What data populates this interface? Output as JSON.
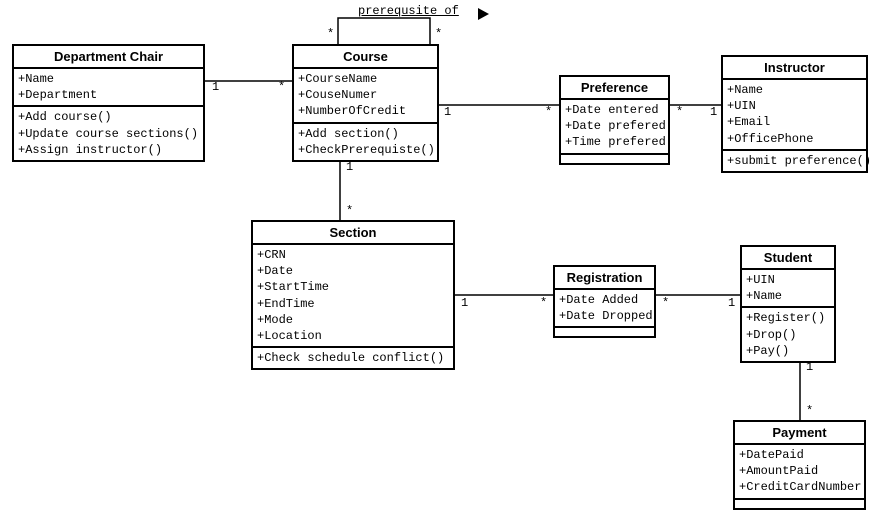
{
  "chart_data": {
    "type": "uml_class_diagram",
    "classes": [
      {
        "id": "department_chair",
        "name": "Department Chair",
        "attributes": [
          "+Name",
          "+Department"
        ],
        "operations": [
          "+Add course()",
          "+Update course sections()",
          "+Assign instructor()"
        ]
      },
      {
        "id": "course",
        "name": "Course",
        "attributes": [
          "+CourseName",
          "+CouseNumer",
          "+NumberOfCredit"
        ],
        "operations": [
          "+Add section()",
          "+CheckPrerequiste()"
        ]
      },
      {
        "id": "preference",
        "name": "Preference",
        "attributes": [
          "+Date entered",
          "+Date prefered",
          "+Time prefered"
        ],
        "operations": []
      },
      {
        "id": "instructor",
        "name": "Instructor",
        "attributes": [
          "+Name",
          "+UIN",
          "+Email",
          "+OfficePhone"
        ],
        "operations": [
          "+submit preference()"
        ]
      },
      {
        "id": "section",
        "name": "Section",
        "attributes": [
          "+CRN",
          "+Date",
          "+StartTime",
          "+EndTime",
          "+Mode",
          "+Location"
        ],
        "operations": [
          "+Check schedule conflict()"
        ]
      },
      {
        "id": "registration",
        "name": "Registration",
        "attributes": [
          "+Date Added",
          "+Date Dropped"
        ],
        "operations": []
      },
      {
        "id": "student",
        "name": "Student",
        "attributes": [
          "+UIN",
          "+Name"
        ],
        "operations": [
          "+Register()",
          "+Drop()",
          "+Pay()"
        ]
      },
      {
        "id": "payment",
        "name": "Payment",
        "attributes": [
          "+DatePaid",
          "+AmountPaid",
          "+CreditCardNumber"
        ],
        "operations": []
      }
    ],
    "associations": [
      {
        "from": "department_chair",
        "to": "course",
        "from_mult": "1",
        "to_mult": "*"
      },
      {
        "from": "course",
        "to": "course",
        "label": "prerequsite of",
        "from_mult": "*",
        "to_mult": "*"
      },
      {
        "from": "course",
        "to": "preference",
        "from_mult": "1",
        "to_mult": "*"
      },
      {
        "from": "preference",
        "to": "instructor",
        "from_mult": "*",
        "to_mult": "1"
      },
      {
        "from": "course",
        "to": "section",
        "from_mult": "1",
        "to_mult": "*"
      },
      {
        "from": "section",
        "to": "registration",
        "from_mult": "1",
        "to_mult": "*"
      },
      {
        "from": "registration",
        "to": "student",
        "from_mult": "*",
        "to_mult": "1"
      },
      {
        "from": "student",
        "to": "payment",
        "from_mult": "1",
        "to_mult": "*"
      }
    ]
  },
  "dc": {
    "title": "Department Chair",
    "a0": "+Name",
    "a1": "+Department",
    "o0": "+Add course()",
    "o1": "+Update course sections()",
    "o2": "+Assign instructor()"
  },
  "course": {
    "title": "Course",
    "a0": "+CourseName",
    "a1": "+CouseNumer",
    "a2": "+NumberOfCredit",
    "o0": "+Add section()",
    "o1": "+CheckPrerequiste()"
  },
  "pref": {
    "title": "Preference",
    "a0": "+Date entered",
    "a1": "+Date prefered",
    "a2": "+Time prefered"
  },
  "instr": {
    "title": "Instructor",
    "a0": "+Name",
    "a1": "+UIN",
    "a2": "+Email",
    "a3": "+OfficePhone",
    "o0": "+submit preference()"
  },
  "section": {
    "title": "Section",
    "a0": "+CRN",
    "a1": "+Date",
    "a2": "+StartTime",
    "a3": "+EndTime",
    "a4": "+Mode",
    "a5": "+Location",
    "o0": "+Check schedule conflict()"
  },
  "reg": {
    "title": "Registration",
    "a0": "+Date Added",
    "a1": "+Date Dropped"
  },
  "student": {
    "title": "Student",
    "a0": "+UIN",
    "a1": "+Name",
    "o0": "+Register()",
    "o1": "+Drop()",
    "o2": "+Pay()"
  },
  "payment": {
    "title": "Payment",
    "a0": "+DatePaid",
    "a1": "+AmountPaid",
    "a2": "+CreditCardNumber"
  },
  "labels": {
    "prereq": "prerequsite of"
  },
  "m": {
    "one": "1",
    "many": "*"
  }
}
